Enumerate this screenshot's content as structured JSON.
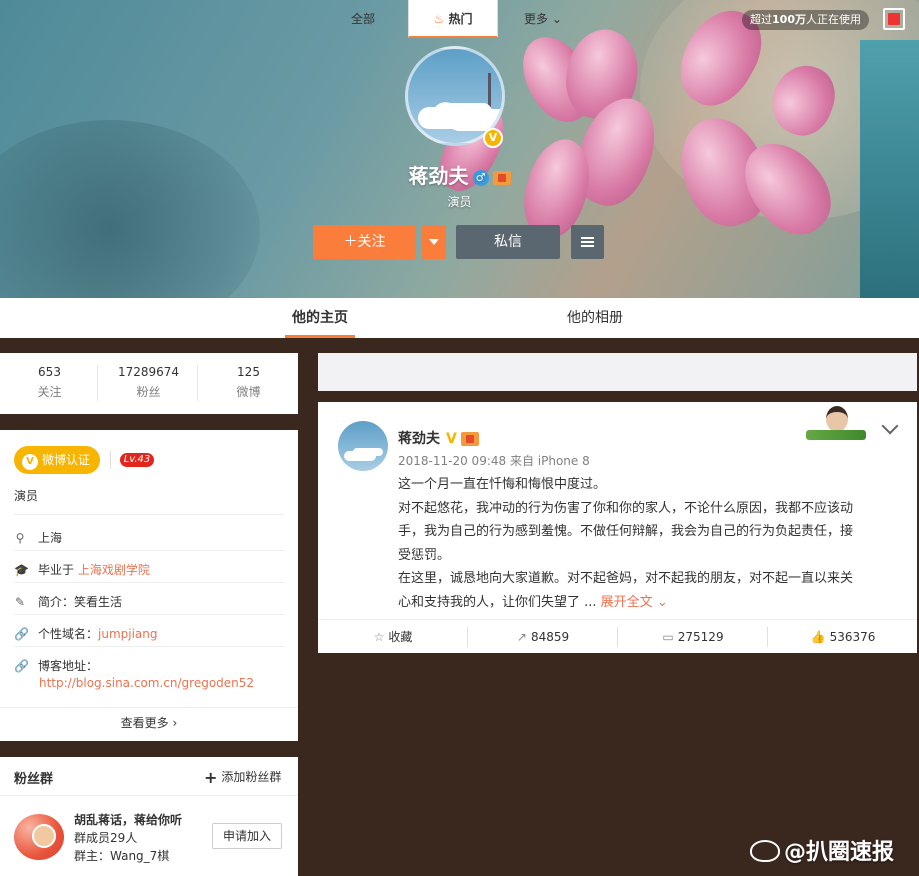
{
  "banner": {
    "usage_prefix": "超过",
    "usage_count": "100万",
    "usage_suffix": "人正在使用"
  },
  "profile": {
    "name": "蒋劲夫",
    "gender_icon": "male-icon",
    "description": "演员",
    "follow_label": "关注",
    "message_label": "私信"
  },
  "tabs": {
    "home": "他的主页",
    "album": "他的相册"
  },
  "stats": [
    {
      "value": "653",
      "label": "关注"
    },
    {
      "value": "17289674",
      "label": "粉丝"
    },
    {
      "value": "125",
      "label": "微博"
    }
  ],
  "info": {
    "verify_label": "微博认证",
    "level": "Lv.43",
    "role": "演员",
    "location": "上海",
    "school_prefix": "毕业于",
    "school": "上海戏剧学院",
    "intro_prefix": "简介：",
    "intro": "笑看生活",
    "domain_prefix": "个性域名：",
    "domain": "jumpjiang",
    "blog_prefix": "博客地址：",
    "blog": "http://blog.sina.com.cn/gregoden52",
    "more_label": "查看更多"
  },
  "fans_group": {
    "title": "粉丝群",
    "add_label": "添加粉丝群",
    "group_name": "胡乱蒋话，蒋给你听",
    "members": "群成员29人",
    "owner": "群主：Wang_7棋",
    "join_label": "申请加入"
  },
  "feed_tabs": {
    "all": "全部",
    "hot": "热门",
    "more": "更多"
  },
  "post": {
    "author": "蒋劲夫",
    "time": "2018-11-20 09:48",
    "source": "来自 iPhone 8",
    "lines": [
      "这一个月一直在忏悔和悔恨中度过。",
      "对不起悠花，我冲动的行为伤害了你和你的家人，不论什么原因，我都不应该动",
      "手，我为自己的行为感到羞愧。不做任何辩解，我会为自己的行为负起责任，接",
      "受惩罚。",
      "在这里，诚恳地向大家道歉。对不起爸妈，对不起我的朋友，对不起一直以来关",
      "心和支持我的人，让你们失望了 ..."
    ],
    "expand_label": "展开全文",
    "actions": {
      "favorite": "收藏",
      "repost": "84859",
      "comment": "275129",
      "like": "536376"
    }
  },
  "watermark": "@扒圈速报",
  "colors": {
    "accent": "#fa7d3c",
    "verify": "#f7b500",
    "link": "#eb7350",
    "page_bg": "#3a281f"
  }
}
